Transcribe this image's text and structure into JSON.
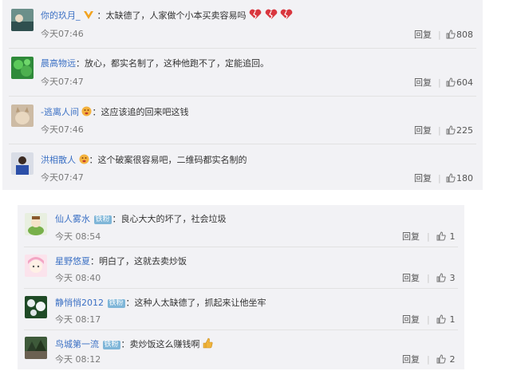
{
  "panel1": {
    "comments": [
      {
        "user": "你的玖月_",
        "text": "：太缺德了，人家做个小本买卖容易吗",
        "time": "今天07:46",
        "reply": "回复",
        "likes": "808"
      },
      {
        "user": "晨高物远",
        "text": "：放心，都实名制了，这种他跑不了，定能追回。",
        "time": "今天07:47",
        "reply": "回复",
        "likes": "604"
      },
      {
        "user": "-逃离人间",
        "text": "：这应该追的回来吧这钱",
        "time": "今天07:46",
        "reply": "回复",
        "likes": "225"
      },
      {
        "user": "洪相散人",
        "text": "：这个破案很容易吧，二维码都实名制的",
        "time": "今天07:47",
        "reply": "回复",
        "likes": "180"
      }
    ]
  },
  "panel2": {
    "comments": [
      {
        "user": "仙人雾水",
        "badge": "铁粉",
        "text": "：良心大大的坏了，社会垃圾",
        "time": "今天 08:54",
        "reply": "回复",
        "likes": "1"
      },
      {
        "user": "星野悠夏",
        "text": "：明白了，这就去卖炒饭",
        "time": "今天 08:40",
        "reply": "回复",
        "likes": "3"
      },
      {
        "user": "静悄悄2012",
        "badge": "铁粉",
        "text": "：这种人太缺德了，抓起来让他坐牢",
        "time": "今天 08:17",
        "reply": "回复",
        "likes": "1"
      },
      {
        "user": "鸟城第一流",
        "badge": "铁粉",
        "text": "：卖炒饭这么赚钱啊",
        "time": "今天 08:12",
        "reply": "回复",
        "likes": "2"
      }
    ]
  },
  "icons": {
    "like": "thumbs-up-icon",
    "broken_heart": "broken-heart-icon",
    "vip": "vip-v-icon",
    "emoji_face": "emoji-face-icon",
    "emoji_thumb": "emoji-thumbs-up-icon"
  },
  "colors": {
    "username": "#3b70c4",
    "badge": "#7fb6d8",
    "panel_bg": "#f2f2f5"
  }
}
